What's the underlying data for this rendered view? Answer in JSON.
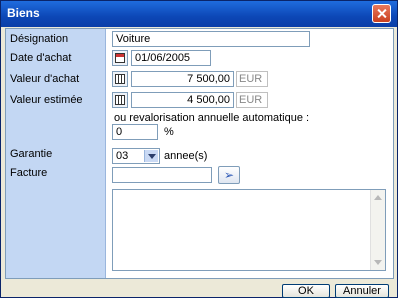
{
  "window": {
    "title": "Biens"
  },
  "labels": {
    "designation": "Désignation",
    "date_achat": "Date d'achat",
    "valeur_achat": "Valeur d'achat",
    "valeur_estimee": "Valeur estimée",
    "garantie": "Garantie",
    "facture": "Facture"
  },
  "fields": {
    "designation_value": "Voiture",
    "date_achat_value": "01/06/2005",
    "valeur_achat_value": "7 500,00",
    "valeur_achat_unit": "EUR",
    "valeur_estimee_value": "4 500,00",
    "valeur_estimee_unit": "EUR",
    "revalorisation_label": "ou revalorisation annuelle automatique :",
    "revalorisation_value": "0",
    "percent_label": "%",
    "garantie_value": "03",
    "garantie_unit": "annee(s)",
    "facture_value": "",
    "notes_value": ""
  },
  "buttons": {
    "ok": "OK",
    "cancel": "Annuler"
  },
  "icons": {
    "close": "close-icon",
    "calendar": "calendar-icon",
    "calculator": "calculator-icon",
    "browse": "browse-arrow-icon",
    "dropdown": "chevron-down-icon"
  }
}
